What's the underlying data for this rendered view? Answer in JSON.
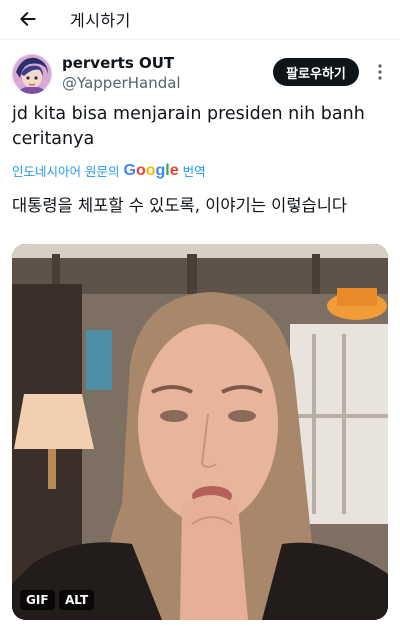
{
  "topbar": {
    "title": "게시하기",
    "back_icon": "arrow-left-icon"
  },
  "post": {
    "author_name": "perverts OUT",
    "author_handle": "@YapperHandal",
    "follow_label": "팔로우하기",
    "more_icon": "more-vertical-icon",
    "text": "jd kita bisa menjarain presiden nih banh ceritanya",
    "translate": {
      "prefix": "인도네시아어 원문의",
      "google": [
        "G",
        "o",
        "o",
        "g",
        "l",
        "e"
      ],
      "suffix": "번역"
    },
    "translated_text": "대통령을 체포할 수 있도록, 이야기는 이렇습니다"
  },
  "media": {
    "gif_label": "GIF",
    "alt_label": "ALT"
  },
  "colors": {
    "accent": "#1d9bf0",
    "text": "#0f1419",
    "muted": "#536471",
    "google": [
      "#4285F4",
      "#EA4335",
      "#FBBC05",
      "#4285F4",
      "#34A853",
      "#EA4335"
    ]
  }
}
